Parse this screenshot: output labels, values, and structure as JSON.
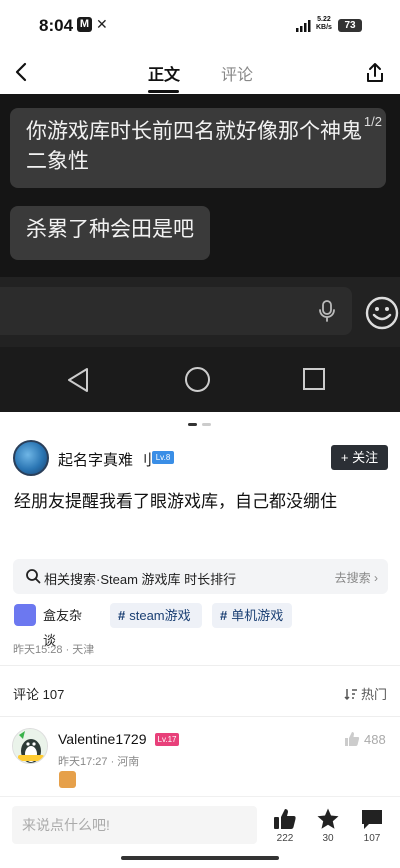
{
  "status_bar": {
    "time": "8:04",
    "app_badge": "M",
    "net_speed_value": "5.22",
    "net_speed_unit": "KB/s",
    "battery": "73"
  },
  "nav": {
    "tab_main": "正文",
    "tab_comments": "评论"
  },
  "image": {
    "page_indicator": "1/2",
    "bubble_1": "你游戏库时长前四名就好像那个神鬼二象性",
    "bubble_2": "杀累了种会田是吧"
  },
  "author": {
    "name": "起名字真难 刂",
    "level": "Lv.8",
    "follow_label": "+ 关注"
  },
  "post": {
    "title": "经朋友提醒我看了眼游戏库，自己都没绷住",
    "related_search": "相关搜索·Steam 游戏库 时长排行",
    "related_go": "去搜索",
    "tags": [
      "盒友杂谈",
      "steam游戏",
      "单机游戏"
    ],
    "meta": "昨天15:28 · 天津"
  },
  "comments": {
    "header": "评论 107",
    "sort_label": "热门",
    "items": [
      {
        "name": "Valentine1729",
        "level": "Lv.17",
        "meta": "昨天17:27 · 河南",
        "likes": "488"
      }
    ]
  },
  "bottom_bar": {
    "input_placeholder": "来说点什么吧!",
    "like_count": "222",
    "favorite_count": "30",
    "comment_count": "107"
  }
}
